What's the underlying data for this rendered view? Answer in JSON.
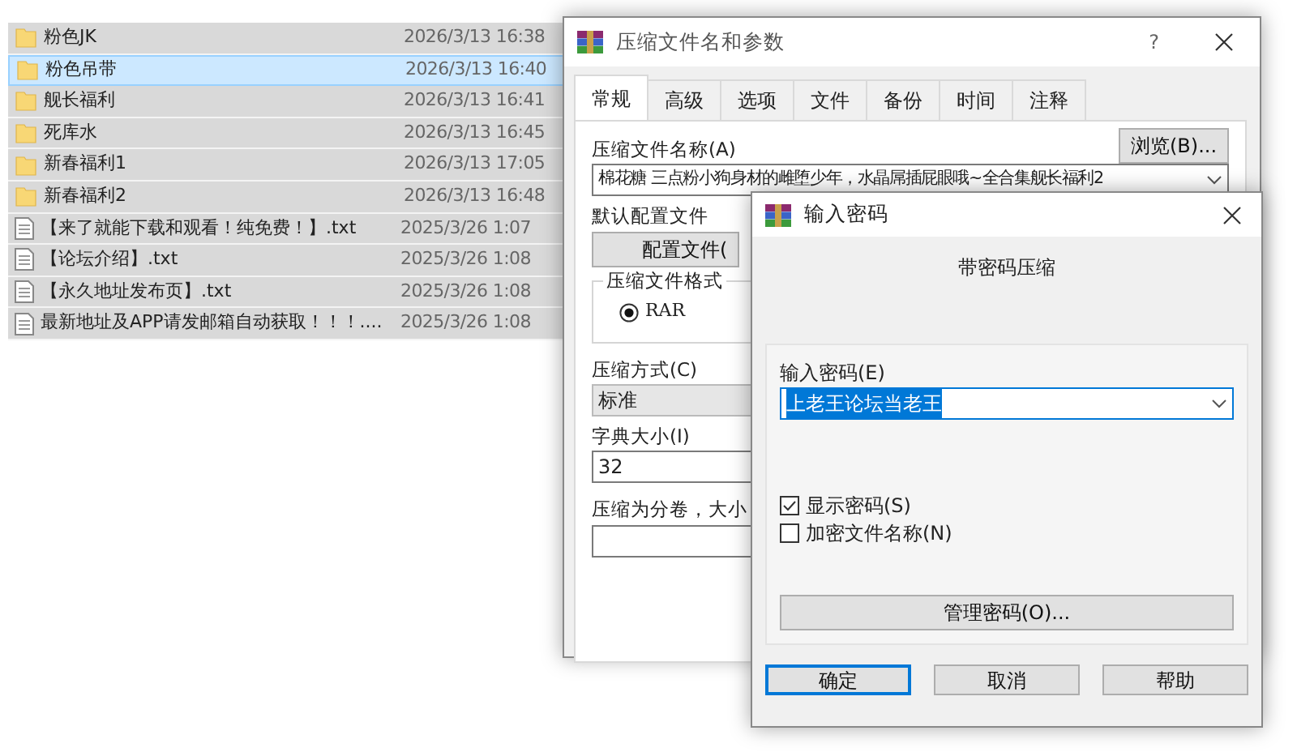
{
  "file_list": {
    "rows": [
      {
        "kind": "folder",
        "name": "粉色JK",
        "modified": "2026/3/13 16:38",
        "selected": false
      },
      {
        "kind": "folder",
        "name": "粉色吊带",
        "modified": "2026/3/13 16:40",
        "selected": true
      },
      {
        "kind": "folder",
        "name": "舰长福利",
        "modified": "2026/3/13 16:41",
        "selected": false
      },
      {
        "kind": "folder",
        "name": "死库水",
        "modified": "2026/3/13 16:45",
        "selected": false
      },
      {
        "kind": "folder",
        "name": "新春福利1",
        "modified": "2026/3/13 17:05",
        "selected": false
      },
      {
        "kind": "folder",
        "name": "新春福利2",
        "modified": "2026/3/13 16:48",
        "selected": false
      },
      {
        "kind": "text",
        "name": "【来了就能下载和观看！纯免费！】.txt",
        "modified": "2025/3/26 1:07",
        "selected": false
      },
      {
        "kind": "text",
        "name": "【论坛介绍】.txt",
        "modified": "2025/3/26 1:08",
        "selected": false
      },
      {
        "kind": "text",
        "name": "【永久地址发布页】.txt",
        "modified": "2025/3/26 1:08",
        "selected": false
      },
      {
        "kind": "text",
        "name": "最新地址及APP请发邮箱自动获取！！！....",
        "modified": "2025/3/26 1:08",
        "selected": false
      }
    ]
  },
  "archive_dialog": {
    "title": "压缩文件名和参数",
    "help": "?",
    "tabs": [
      {
        "label": "常规",
        "selected": true
      },
      {
        "label": "高级",
        "selected": false
      },
      {
        "label": "选项",
        "selected": false
      },
      {
        "label": "文件",
        "selected": false
      },
      {
        "label": "备份",
        "selected": false
      },
      {
        "label": "时间",
        "selected": false
      },
      {
        "label": "注释",
        "selected": false
      }
    ],
    "archive_name_label": "压缩文件名称(A)",
    "browse_button": "浏览(B)...",
    "archive_name_value": "棉花糖 三点粉小狗身材的雌堕少年，水晶屌插屁眼哦~全合集舰长福利2",
    "profile_label": "默认配置文件",
    "profile_button": "配置文件(",
    "format_group_label": "压缩文件格式",
    "format_options": [
      {
        "label": "RAR",
        "selected": true
      }
    ],
    "method_label": "压缩方式(C)",
    "method_value": "标准",
    "dictionary_label": "字典大小(I)",
    "dictionary_value": "32",
    "volume_label": "压缩为分卷，大小"
  },
  "password_dialog": {
    "title": "输入密码",
    "heading": "带密码压缩",
    "password_label": "输入密码(E)",
    "password_value": "上老王论坛当老王",
    "options": [
      {
        "label": "显示密码(S)",
        "checked": true
      },
      {
        "label": "加密文件名称(N)",
        "checked": false
      }
    ],
    "manage_button": "管理密码(O)...",
    "buttons": [
      {
        "label": "确定",
        "default": true
      },
      {
        "label": "取消",
        "default": false
      },
      {
        "label": "帮助",
        "default": false
      }
    ]
  }
}
